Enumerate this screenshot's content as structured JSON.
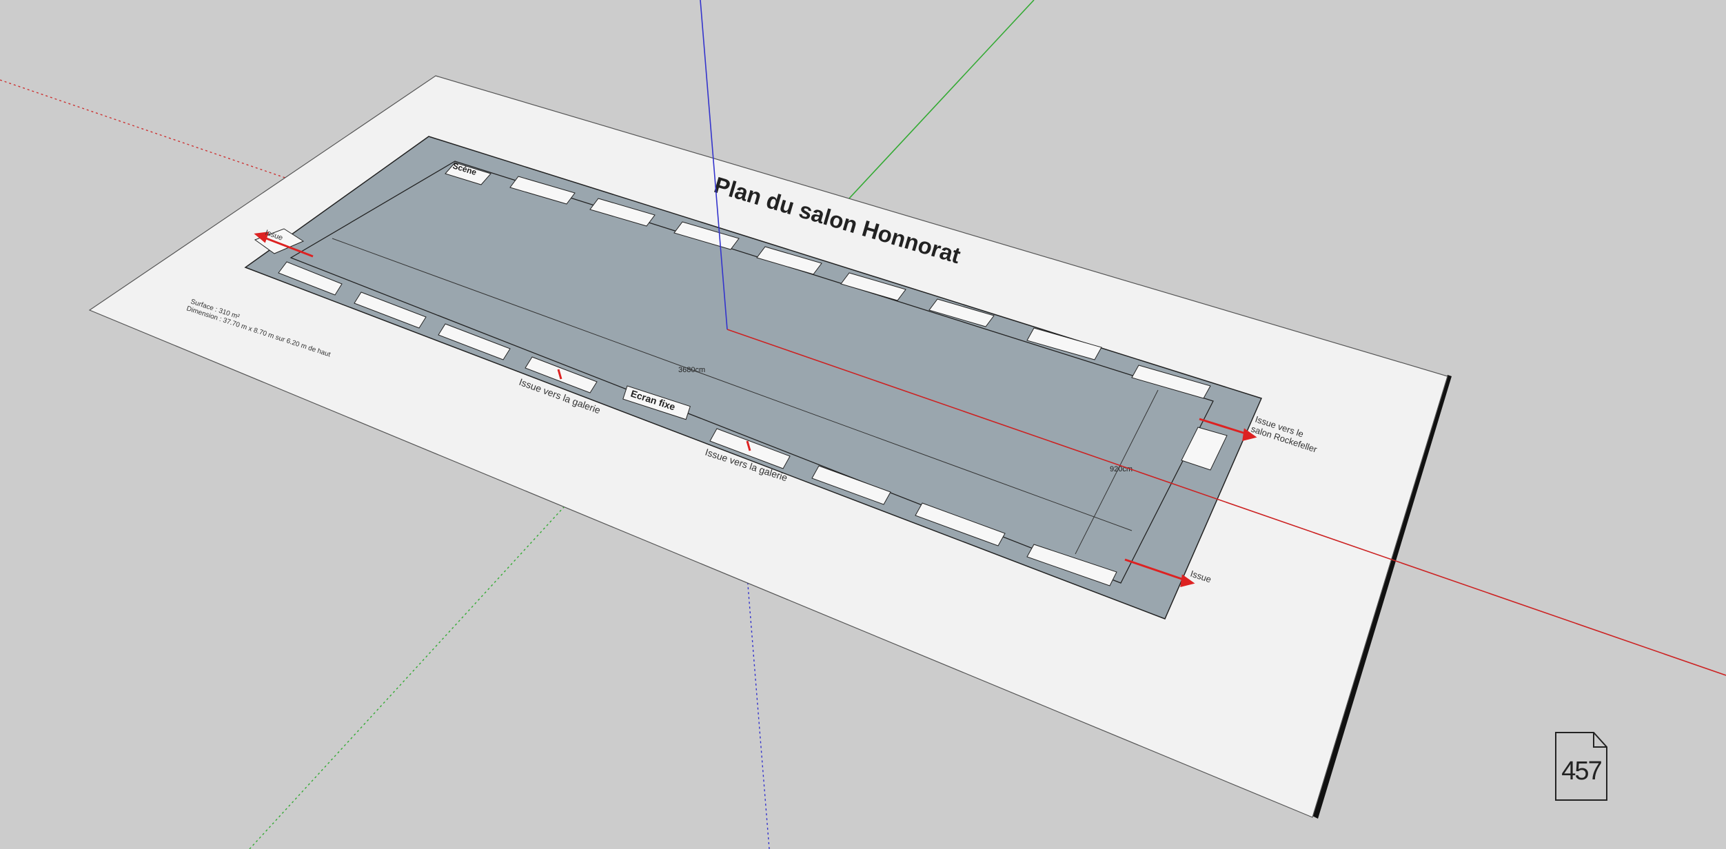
{
  "viewport": {
    "background_color": "#cccccc",
    "paper_color": "#f2f2f2",
    "room_fill_color": "#9aa6ae",
    "axis_colors": {
      "red": "#cc2222",
      "green": "#22aa22",
      "blue": "#2222cc"
    }
  },
  "plan": {
    "title": "Plan du salon Honnorat",
    "info_surface": "Surface : 310 m²",
    "info_dimension": "Dimension : 37.70 m x 8.70 m sur 6.20 m de haut",
    "dimension_length": "3680cm",
    "dimension_width": "920cm",
    "label_scene": "Scène",
    "label_screen": "Ecran fixe",
    "exit_left": "Issue",
    "exit_gallery_1": "Issue vers la galerie",
    "exit_gallery_2": "Issue vers la galerie",
    "exit_right_line1": "Issue vers le",
    "exit_right_line2": "salon Rockefeller",
    "exit_bottom_right": "Issue"
  },
  "page_counter": {
    "value": "457",
    "icon": "page-icon"
  }
}
